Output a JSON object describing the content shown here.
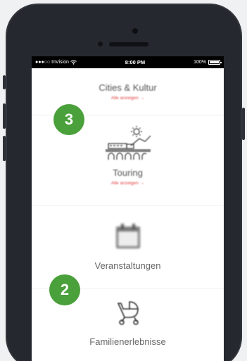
{
  "statusbar": {
    "carrier": "●●●○○ InVision",
    "wifi_icon": "wifi-icon",
    "time": "8:00 PM",
    "battery": "100%"
  },
  "sections": [
    {
      "title": "Cities & Kultur",
      "link": "Alle anzeigen"
    },
    {
      "title": "Touring",
      "link": "Alle anzeigen",
      "icon": "train-bridge-icon"
    },
    {
      "title": "Veranstaltungen",
      "icon": "calendar-icon"
    },
    {
      "title": "Familienerlebnisse",
      "icon": "stroller-icon"
    }
  ],
  "arrow": "→",
  "badges": [
    {
      "label": "3"
    },
    {
      "label": "2"
    }
  ],
  "colors": {
    "badge": "#4aa03a",
    "link": "#e04545",
    "phone": "#25292f"
  }
}
